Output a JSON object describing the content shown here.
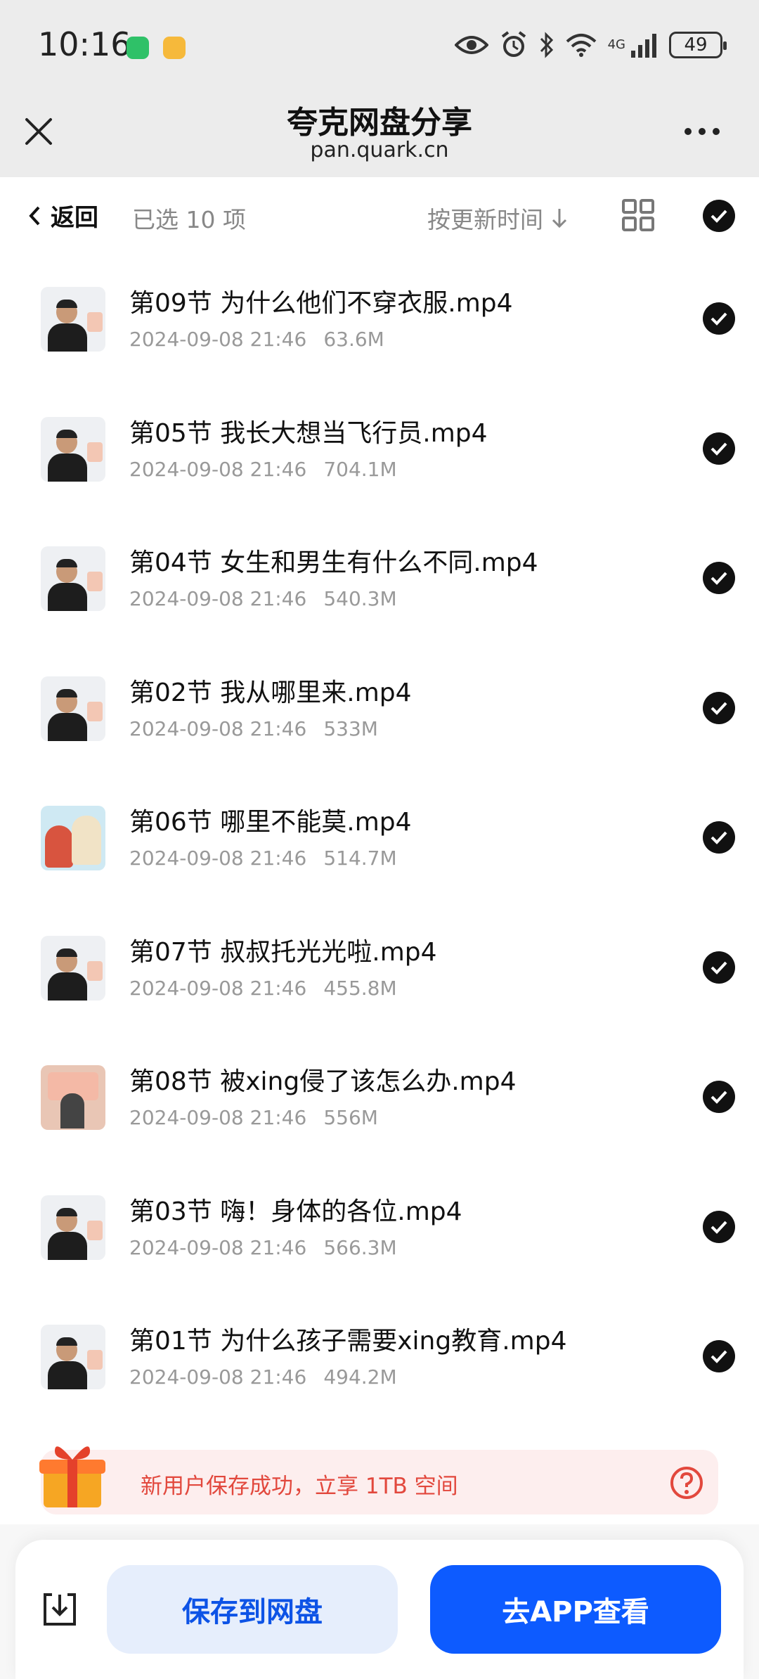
{
  "status_bar": {
    "time": "10:16",
    "battery": "49",
    "network": "4G"
  },
  "nav": {
    "title": "夸克网盘分享",
    "url": "pan.quark.cn"
  },
  "toolbar": {
    "back_label": "返回",
    "selected_label": "已选 10 项",
    "sort_label": "按更新时间"
  },
  "files": [
    {
      "name": "第09节 为什么他们不穿衣服.mp4",
      "date": "2024-09-08 21:46",
      "size": "63.6M",
      "thumb": "person"
    },
    {
      "name": "第05节 我长大想当飞行员.mp4",
      "date": "2024-09-08 21:46",
      "size": "704.1M",
      "thumb": "person"
    },
    {
      "name": "第04节 女生和男生有什么不同.mp4",
      "date": "2024-09-08 21:46",
      "size": "540.3M",
      "thumb": "person"
    },
    {
      "name": "第02节 我从哪里来.mp4",
      "date": "2024-09-08 21:46",
      "size": "533M",
      "thumb": "person"
    },
    {
      "name": "第06节 哪里不能莫.mp4",
      "date": "2024-09-08 21:46",
      "size": "514.7M",
      "thumb": "cartoon"
    },
    {
      "name": "第07节 叔叔托光光啦.mp4",
      "date": "2024-09-08 21:46",
      "size": "455.8M",
      "thumb": "person"
    },
    {
      "name": "第08节 被xing侵了该怎么办.mp4",
      "date": "2024-09-08 21:46",
      "size": "556M",
      "thumb": "scene"
    },
    {
      "name": "第03节 嗨！身体的各位.mp4",
      "date": "2024-09-08 21:46",
      "size": "566.3M",
      "thumb": "person"
    },
    {
      "name": "第01节 为什么孩子需要xing教育.mp4",
      "date": "2024-09-08 21:46",
      "size": "494.2M",
      "thumb": "person"
    }
  ],
  "promo": {
    "text": "新用户保存成功，立享 1TB 空间"
  },
  "actions": {
    "save_label": "保存到网盘",
    "open_label": "去APP查看"
  },
  "colors": {
    "accent": "#0d5bff",
    "promo_text": "#e2483d"
  }
}
